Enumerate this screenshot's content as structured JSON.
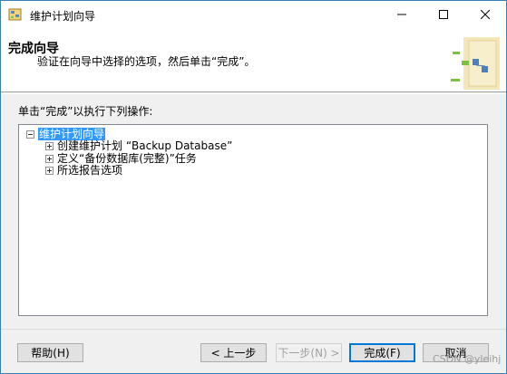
{
  "window": {
    "title": "维护计划向导"
  },
  "header": {
    "title": "完成向导",
    "subtitle": "验证在向导中选择的选项，然后单击“完成”。"
  },
  "main": {
    "section_label": "单击“完成”以执行下列操作:",
    "tree": {
      "root": "维护计划向导",
      "children": [
        "创建维护计划 “Backup Database”",
        "定义“备份数据库(完整)”任务",
        "所选报告选项"
      ]
    }
  },
  "buttons": {
    "help": "帮助(H)",
    "back": "< 上一步",
    "next": "下一步(N) >",
    "finish": "完成(F)",
    "cancel": "取消"
  },
  "watermark": "CSDN @yleihj"
}
